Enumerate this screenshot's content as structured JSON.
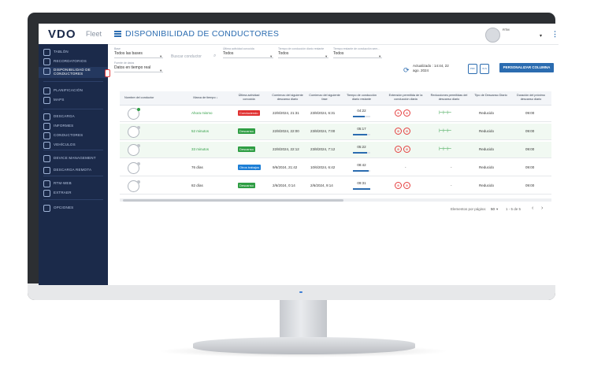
{
  "app": {
    "logo": "VDO",
    "product": "Fleet",
    "page_title": "DISPONIBILIDAD DE CONDUCTORES",
    "user_label": "RTM"
  },
  "sidebar": {
    "items": [
      {
        "label": "TABLÓN",
        "icon": "dashboard-icon"
      },
      {
        "label": "RECORDATORIOS",
        "icon": "bell-icon"
      },
      {
        "label": "DISPONIBILIDAD DE CONDUCTORES",
        "icon": "clock-icon",
        "active": true
      },
      {
        "label": "PLANIFICACIÓN",
        "icon": "calendar-icon"
      },
      {
        "label": "MAPS",
        "icon": "map-icon"
      },
      {
        "label": "DESCARGA",
        "icon": "download-icon"
      },
      {
        "label": "INFORMES",
        "icon": "report-icon"
      },
      {
        "label": "CONDUCTORES",
        "icon": "driver-icon"
      },
      {
        "label": "VEHÍCULOS",
        "icon": "truck-icon"
      },
      {
        "label": "DEVICE MANAGEMENT",
        "icon": "device-icon"
      },
      {
        "label": "DESCARGA REMOTA",
        "icon": "remote-download-icon"
      },
      {
        "label": "RTM-WEB",
        "icon": "web-icon"
      },
      {
        "label": "EXTRAER",
        "icon": "extract-icon"
      },
      {
        "label": "OPCIONES",
        "icon": "settings-icon"
      }
    ]
  },
  "filters": {
    "base": {
      "caption": "Base",
      "value": "Todos las bases"
    },
    "search_placeholder": "Buscar conductor",
    "last_activity": {
      "caption": "Última actividad conocida",
      "value": "Todos"
    },
    "remaining_drive": {
      "caption": "Tiempo de conducción diario restante",
      "value": "Todos"
    },
    "remaining_drive2": {
      "caption": "Tiempo restante de conducción sem...",
      "value": "Todos"
    },
    "data_source": {
      "caption": "Fuente de datos",
      "value": "Datos en tiempo real"
    },
    "updated": "Actualizado : 14:44, 22 ago. 2024",
    "customize_button": "PERSONALIZAR COLUMNA"
  },
  "table": {
    "headers": [
      "Nombre del conductor",
      "Marca de tiempo ↓",
      "Última actividad conocida",
      "Comienzo del siguiente descanso diario",
      "Comienzo del siguiente fase",
      "Tiempo de conducción diario restante",
      "Extensión permitida de la conducción diaria",
      "Reducciones permitidas del descanso diario",
      "Tipo de Descanso Diario",
      "Duración del próximo descanso diario"
    ],
    "rows": [
      {
        "online": true,
        "timestamp": "Ahora mismo",
        "ts_green": true,
        "activity": "Conduciendo",
        "activity_color": "#e03131",
        "next_rest": "22/8/2024, 21:31",
        "next_phase": "23/8/2024, 6:31",
        "drive_left": "04:22",
        "drive_pct": 0.7,
        "ext": true,
        "red": true,
        "rest_type": "Reducido",
        "rest_dur": "09:00"
      },
      {
        "online": false,
        "timestamp": "52 minutos",
        "ts_green": true,
        "activity": "Descanso",
        "activity_color": "#2f9e44",
        "next_rest": "22/8/2024, 22:00",
        "next_phase": "23/8/2024, 7:00",
        "drive_left": "05:17",
        "drive_pct": 0.8,
        "ext": true,
        "red": true,
        "rest_type": "Reducido",
        "rest_dur": "09:00"
      },
      {
        "online": false,
        "timestamp": "33 minutos",
        "ts_green": true,
        "activity": "Descanso",
        "activity_color": "#2f9e44",
        "next_rest": "22/8/2024, 22:12",
        "next_phase": "23/8/2024, 7:12",
        "drive_left": "05:22",
        "drive_pct": 0.8,
        "ext": true,
        "red": true,
        "rest_type": "Reducido",
        "rest_dur": "09:00"
      },
      {
        "online": false,
        "timestamp": "76 días",
        "ts_green": false,
        "activity": "Otros trabajos",
        "activity_color": "#1c7ed6",
        "next_rest": "9/6/2024, 21:42",
        "next_phase": "10/6/2024, 6:42",
        "drive_left": "08:42",
        "drive_pct": 0.9,
        "ext": false,
        "red": false,
        "rest_type": "Reducido",
        "rest_dur": "09:00"
      },
      {
        "online": false,
        "timestamp": "82 días",
        "ts_green": false,
        "activity": "Descanso",
        "activity_color": "#2f9e44",
        "next_rest": "2/6/2024, 0:14",
        "next_phase": "2/6/2024, 9:14",
        "drive_left": "09:31",
        "drive_pct": 1.0,
        "ext": true,
        "red": false,
        "rest_type": "Reducido",
        "rest_dur": "09:00"
      }
    ],
    "dash": "-"
  },
  "pager": {
    "per_page_label": "Elementos por página:",
    "per_page": "50",
    "range": "1 - 5 de 5",
    "prev": "‹",
    "next": "›"
  }
}
